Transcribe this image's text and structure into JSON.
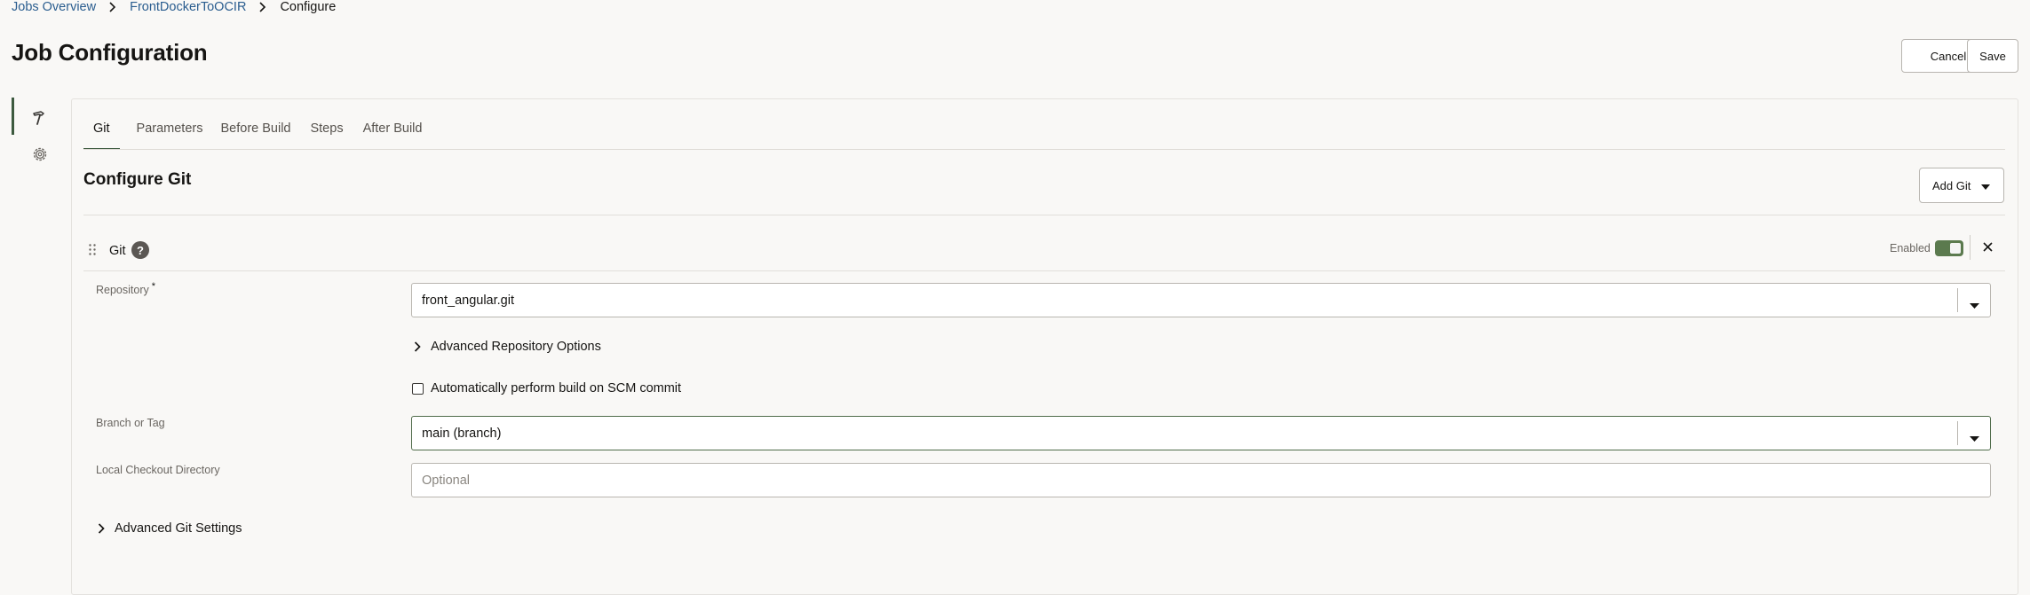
{
  "breadcrumb": {
    "items": [
      {
        "label": "Jobs Overview"
      },
      {
        "label": "FrontDockerToOCIR"
      },
      {
        "label": "Configure"
      }
    ]
  },
  "page": {
    "title": "Job Configuration",
    "cancel_label": "Cancel",
    "save_label": "Save"
  },
  "rail": {
    "items": [
      {
        "icon": "hammer-icon",
        "active": true
      },
      {
        "icon": "gear-icon",
        "active": false
      }
    ]
  },
  "tabs": [
    {
      "label": "Git",
      "active": true
    },
    {
      "label": "Parameters",
      "active": false
    },
    {
      "label": "Before Build",
      "active": false
    },
    {
      "label": "Steps",
      "active": false
    },
    {
      "label": "After Build",
      "active": false
    }
  ],
  "section": {
    "title": "Configure Git",
    "add_button_label": "Add Git"
  },
  "git_block": {
    "label": "Git",
    "help_symbol": "?",
    "enabled_label": "Enabled",
    "enabled": true,
    "repository": {
      "label": "Repository",
      "required_mark": "*",
      "value": "front_angular.git"
    },
    "advanced_repo_label": "Advanced Repository Options",
    "auto_build": {
      "label": "Automatically perform build on SCM commit",
      "checked": false
    },
    "branch": {
      "label": "Branch or Tag",
      "value": "main (branch)"
    },
    "checkout_dir": {
      "label": "Local Checkout Directory",
      "value": "",
      "placeholder": "Optional"
    },
    "advanced_git_label": "Advanced Git Settings"
  },
  "colors": {
    "accent": "#3d5a3f",
    "link": "#2a5d8f",
    "toggle_on": "#5b7a4e",
    "background": "#f9f8f6"
  }
}
